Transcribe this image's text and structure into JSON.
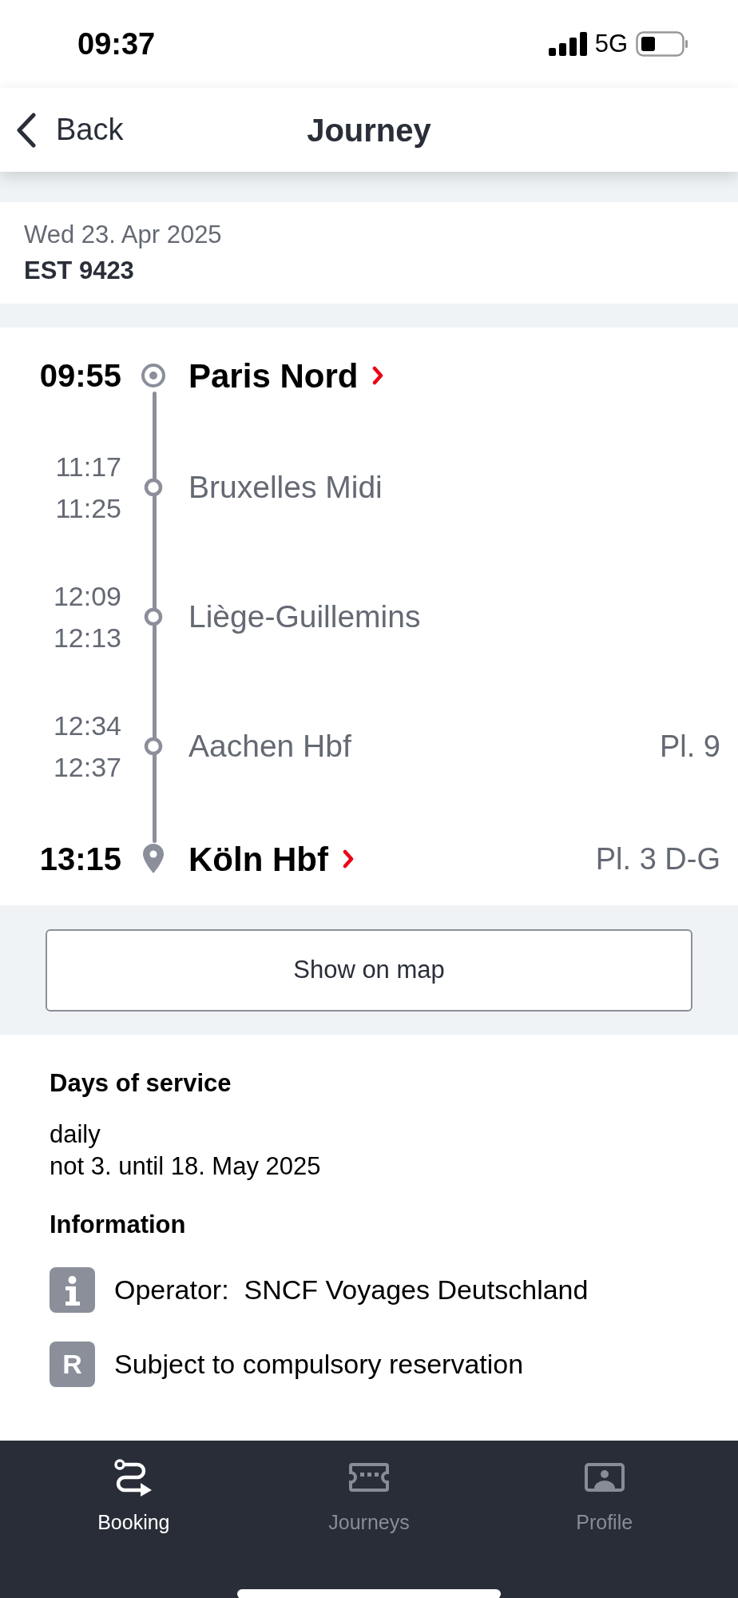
{
  "status_bar": {
    "time": "09:37",
    "network": "5G"
  },
  "header": {
    "back": "Back",
    "title": "Journey"
  },
  "trip": {
    "date": "Wed 23. Apr 2025",
    "train": "EST 9423"
  },
  "stops": [
    {
      "kind": "origin",
      "times": [
        "09:55"
      ],
      "name": "Paris Nord"
    },
    {
      "kind": "stop",
      "times": [
        "11:17",
        "11:25"
      ],
      "name": "Bruxelles Midi"
    },
    {
      "kind": "stop",
      "times": [
        "12:09",
        "12:13"
      ],
      "name": "Liège-Guillemins"
    },
    {
      "kind": "stop",
      "times": [
        "12:34",
        "12:37"
      ],
      "name": "Aachen Hbf",
      "platform": "Pl. 9"
    },
    {
      "kind": "destination",
      "times": [
        "13:15"
      ],
      "name": "Köln Hbf",
      "platform": "Pl. 3 D-G"
    }
  ],
  "map_button": "Show on map",
  "days_of_service": {
    "heading": "Days of service",
    "lines": [
      "daily",
      "not 3. until 18. May 2025"
    ]
  },
  "information": {
    "heading": "Information",
    "items": [
      {
        "kind": "info",
        "text": "Operator:  SNCF Voyages Deutschland"
      },
      {
        "kind": "letter",
        "badge": "R",
        "text": "Subject to compulsory reservation"
      }
    ]
  },
  "tab_bar": [
    {
      "kind": "route",
      "label": "Booking",
      "selected": true
    },
    {
      "kind": "ticket",
      "label": "Journeys",
      "selected": false
    },
    {
      "kind": "profile",
      "label": "Profile",
      "selected": false
    }
  ]
}
